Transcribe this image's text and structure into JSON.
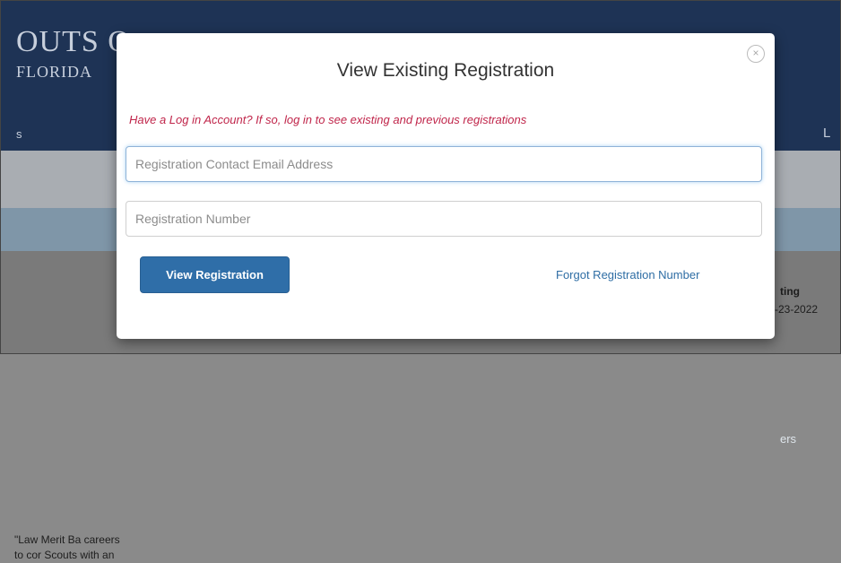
{
  "background": {
    "title_line1": "OUTS O",
    "title_line2": "FLORIDA",
    "nav_left": "s",
    "nav_right": "L",
    "bar_right": "ers",
    "content_text": "\"Law Merit Ba careers to cor Scouts with an",
    "right_line1": "ting",
    "right_line2": "-23-2022"
  },
  "modal": {
    "title": "View Existing Registration",
    "close_icon": "×",
    "notice": "Have a Log in Account? If so, log in to see existing and previous registrations",
    "email_placeholder": "Registration Contact Email Address",
    "email_value": "",
    "registration_placeholder": "Registration Number",
    "registration_value": "",
    "view_button": "View Registration",
    "forgot_link": "Forgot Registration Number"
  },
  "colors": {
    "notice": "#c0254a",
    "button": "#2f6ea8",
    "link": "#2e6da4",
    "header": "#1e3355"
  }
}
